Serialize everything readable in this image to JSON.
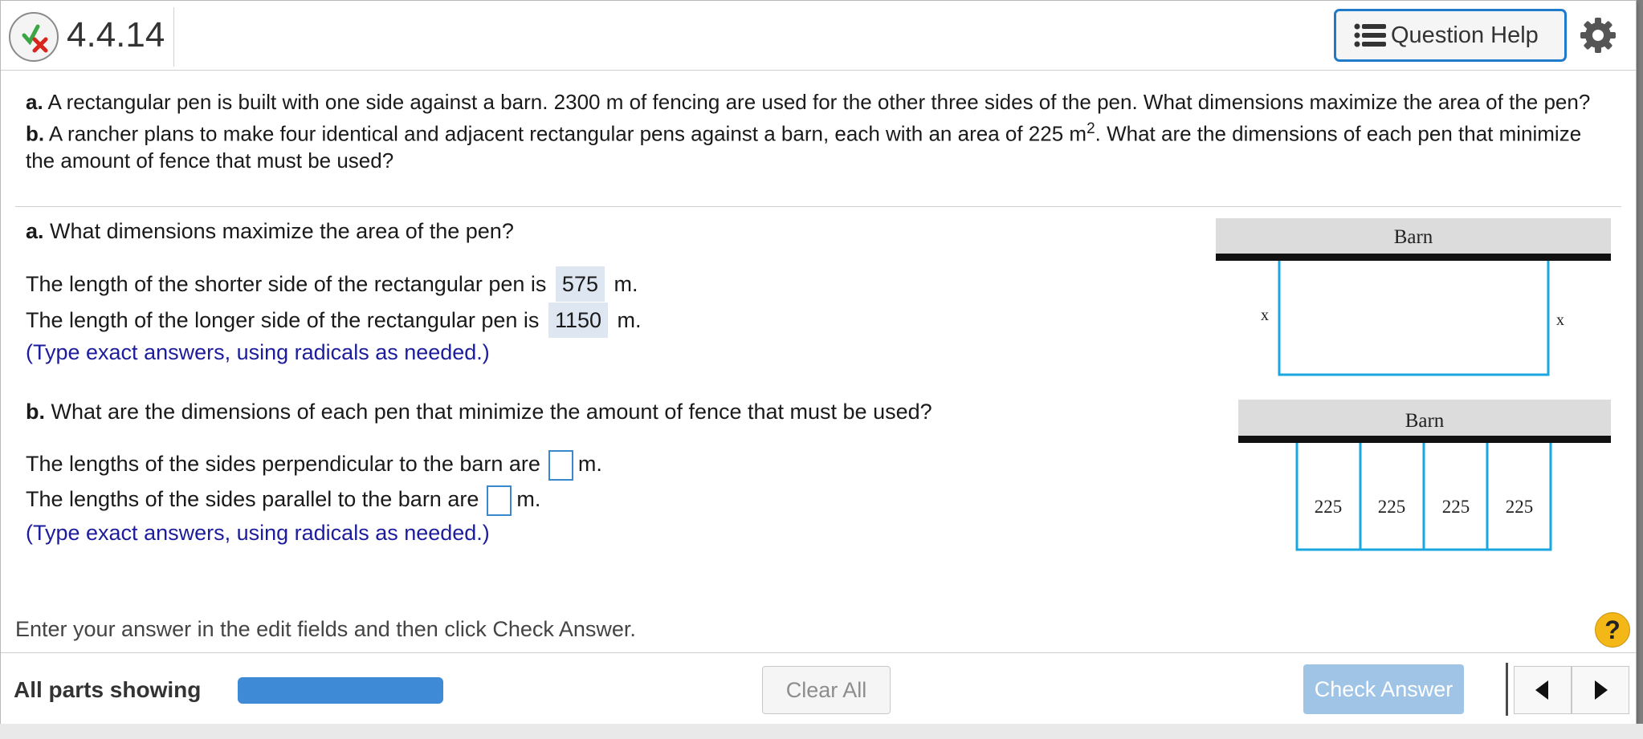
{
  "header": {
    "question_number": "4.4.14",
    "help_label": "Question Help",
    "help_icon": "list-icon",
    "settings_icon": "gear-icon",
    "status_icon": "partial-correct-icon"
  },
  "problem": {
    "part_a_prefix": "a.",
    "part_a_text": "A rectangular pen is built with one side against a barn. 2300 m of fencing are used for the other three sides of the pen. What dimensions maximize the area of the pen?",
    "part_b_prefix": "b.",
    "part_b_text_1": "A rancher plans to make four identical and adjacent rectangular pens against a barn, each with an area of 225 m",
    "part_b_exponent": "2",
    "part_b_text_2": ". What are the dimensions of each pen that minimize the amount of fence that must be used?"
  },
  "part_a": {
    "prefix": "a.",
    "question": "What dimensions maximize the area of the pen?",
    "shorter_label": "The length of the shorter side of the rectangular pen is",
    "shorter_value": "575",
    "longer_label": "The length of the longer side of the rectangular pen is",
    "longer_value": "1150",
    "unit": "m.",
    "hint": "(Type exact answers, using radicals as needed.)",
    "figure": {
      "barn_label": "Barn",
      "side_label": "x"
    }
  },
  "part_b": {
    "prefix": "b.",
    "question": "What are the dimensions of each pen that minimize the amount of fence that must be used?",
    "perp_label": "The lengths of the sides perpendicular to the barn are",
    "perp_value": "",
    "parallel_label": "The lengths of the sides parallel to the barn are",
    "parallel_value": "",
    "unit": "m.",
    "hint": "(Type exact answers, using radicals as needed.)",
    "figure": {
      "barn_label": "Barn",
      "pen_labels": [
        "225",
        "225",
        "225",
        "225"
      ]
    }
  },
  "instruction": "Enter your answer in the edit fields and then click Check Answer.",
  "help_badge": "?",
  "footer": {
    "parts_label": "All parts showing",
    "progress": 1.0,
    "clear_label": "Clear All",
    "check_label": "Check Answer"
  },
  "colors": {
    "accent": "#1f7ac9",
    "progress": "#3e8ad6",
    "check_disabled": "#9fc4e6",
    "hint_text": "#1c1c9c",
    "pen_stroke": "#1aa7e0",
    "answer_bg": "#dde6f1"
  }
}
